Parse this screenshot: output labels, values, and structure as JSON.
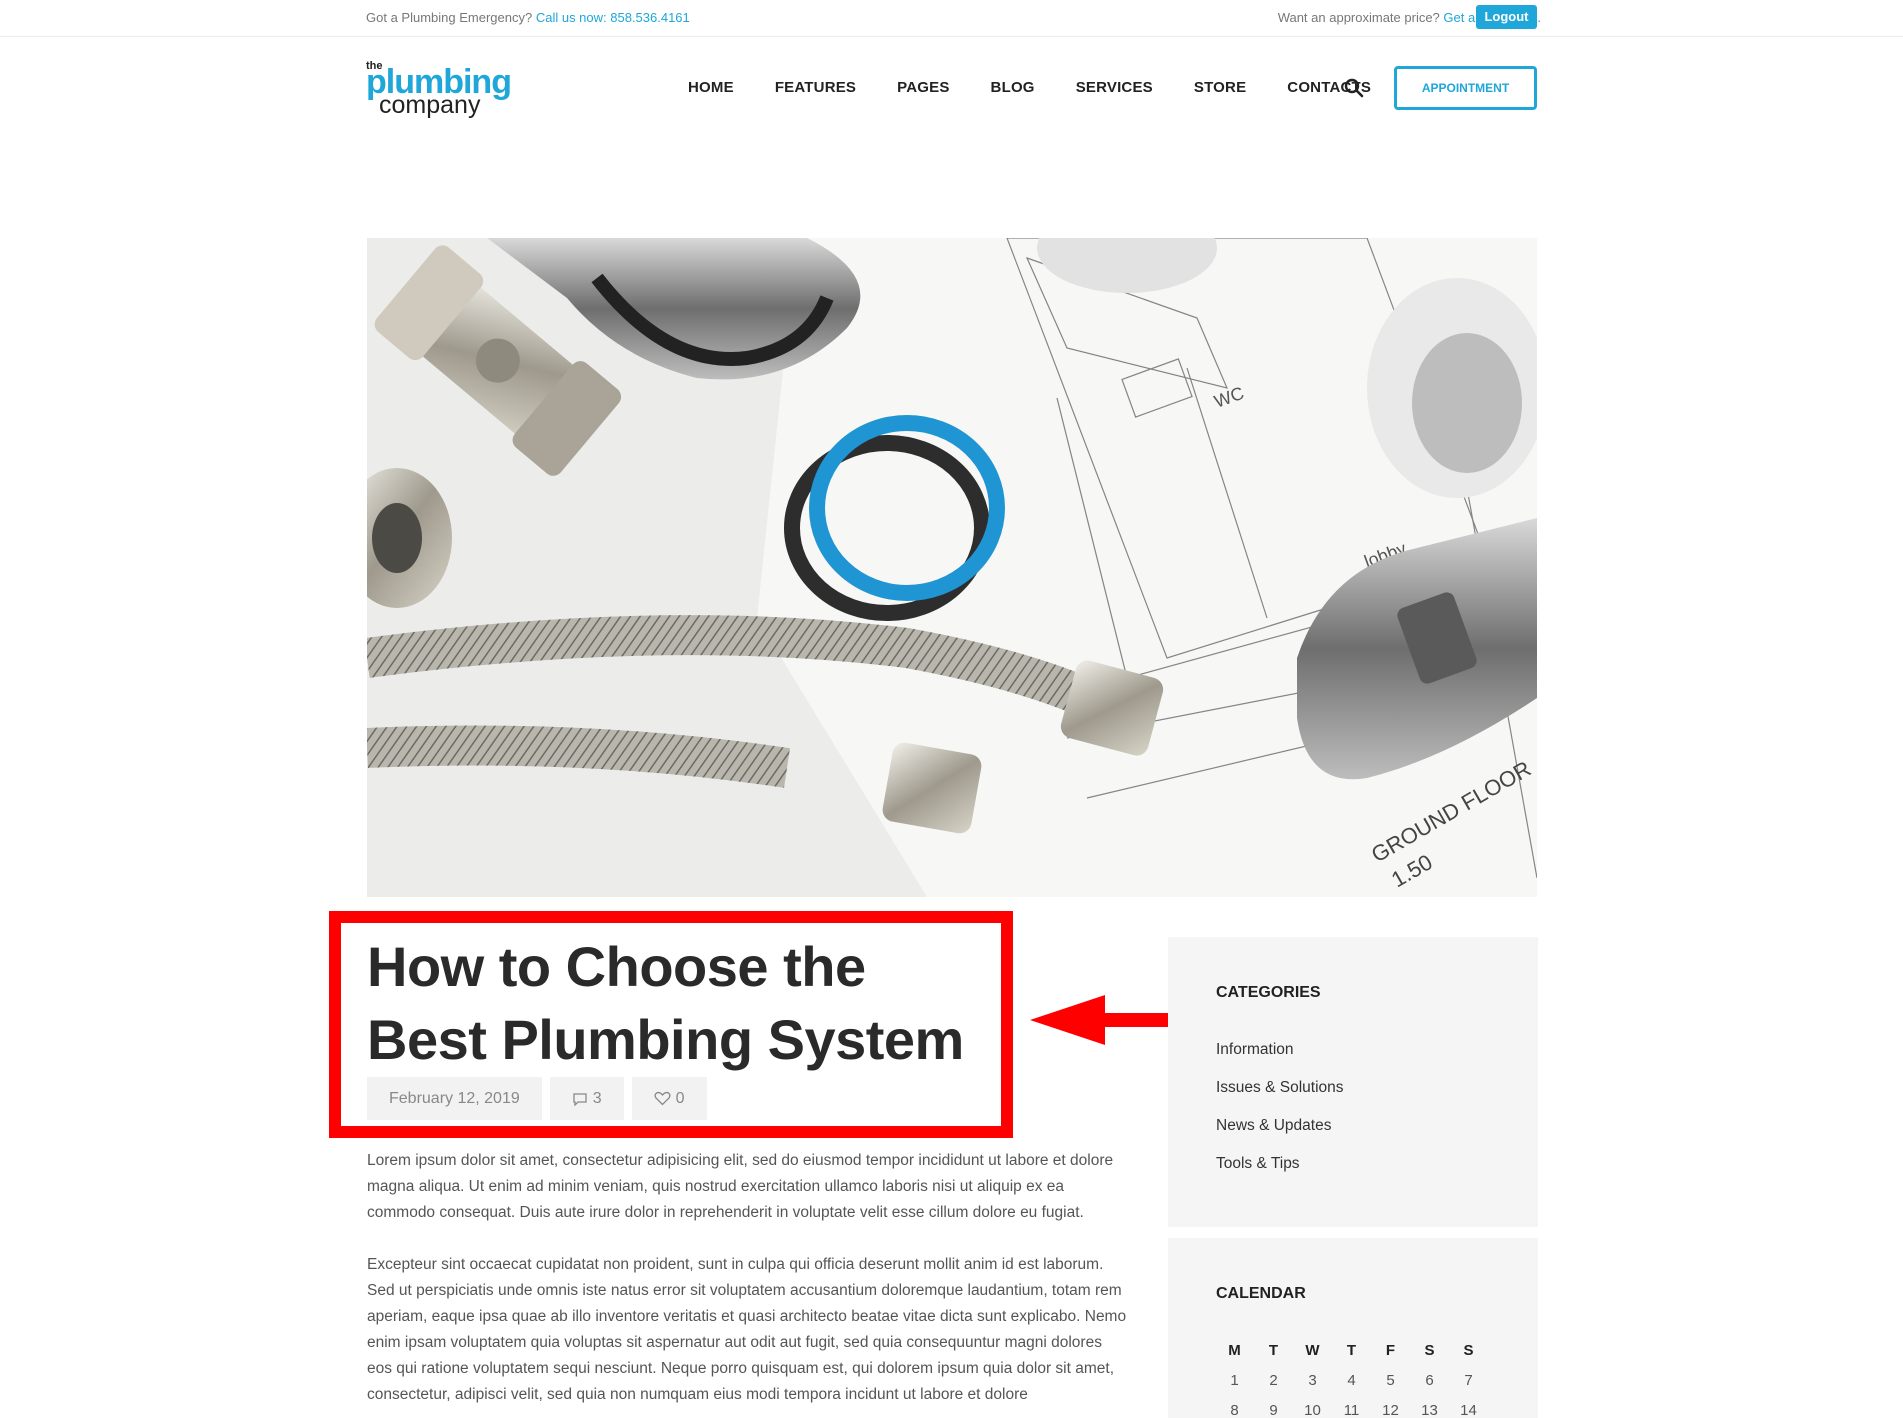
{
  "topbar": {
    "emergency_text": "Got a Plumbing Emergency?",
    "call_link": "Call us now: 858.536.4161",
    "price_text": "Want an approximate price?",
    "quote_link": "Get a free quote.",
    "logout_label": "Logout"
  },
  "logo": {
    "the": "the",
    "plumbing": "plumbing",
    "company": "company"
  },
  "nav": {
    "items": [
      "HOME",
      "FEATURES",
      "PAGES",
      "BLOG",
      "SERVICES",
      "STORE",
      "CONTACTS"
    ],
    "appointment_label": "APPOINTMENT"
  },
  "post": {
    "title": "How to Choose the Best Plumbing System",
    "date": "February 12, 2019",
    "comments": "3",
    "likes": "0",
    "paragraphs": [
      "Lorem ipsum dolor sit amet, consectetur adipisicing elit, sed do eiusmod tempor incididunt ut labore et dolore magna aliqua. Ut enim ad minim veniam, quis nostrud exercitation ullamco laboris nisi ut aliquip ex ea commodo consequat. Duis aute irure dolor in reprehenderit in voluptate velit esse cillum dolore eu fugiat.",
      "Excepteur sint occaecat cupidatat non proident, sunt in culpa qui officia deserunt mollit anim id est laborum. Sed ut perspiciatis unde omnis iste natus error sit voluptatem accusantium doloremque laudantium, totam rem aperiam, eaque ipsa quae ab illo inventore veritatis et quasi architecto beatae vitae dicta sunt explicabo. Nemo enim ipsam voluptatem quia voluptas sit aspernatur aut odit aut fugit, sed quia consequuntur magni dolores eos qui ratione voluptatem sequi nesciunt. Neque porro quisquam est, qui dolorem ipsum quia dolor sit amet, consectetur, adipisci velit, sed quia non numquam eius modi tempora incidunt ut labore et dolore"
    ]
  },
  "sidebar": {
    "categories_title": "CATEGORIES",
    "categories": [
      "Information",
      "Issues & Solutions",
      "News & Updates",
      "Tools & Tips"
    ],
    "calendar_title": "CALENDAR",
    "calendar_days": [
      "M",
      "T",
      "W",
      "T",
      "F",
      "S",
      "S"
    ],
    "calendar_rows": [
      [
        "1",
        "2",
        "3",
        "4",
        "5",
        "6",
        "7"
      ],
      [
        "8",
        "9",
        "10",
        "11",
        "12",
        "13",
        "14"
      ]
    ]
  },
  "hero_image": {
    "blueprint_labels": [
      "lobby",
      "GROUND FLOOR",
      "1.50",
      "WC"
    ]
  },
  "colors": {
    "accent": "#1ea7d8",
    "highlight": "#ff0000"
  }
}
